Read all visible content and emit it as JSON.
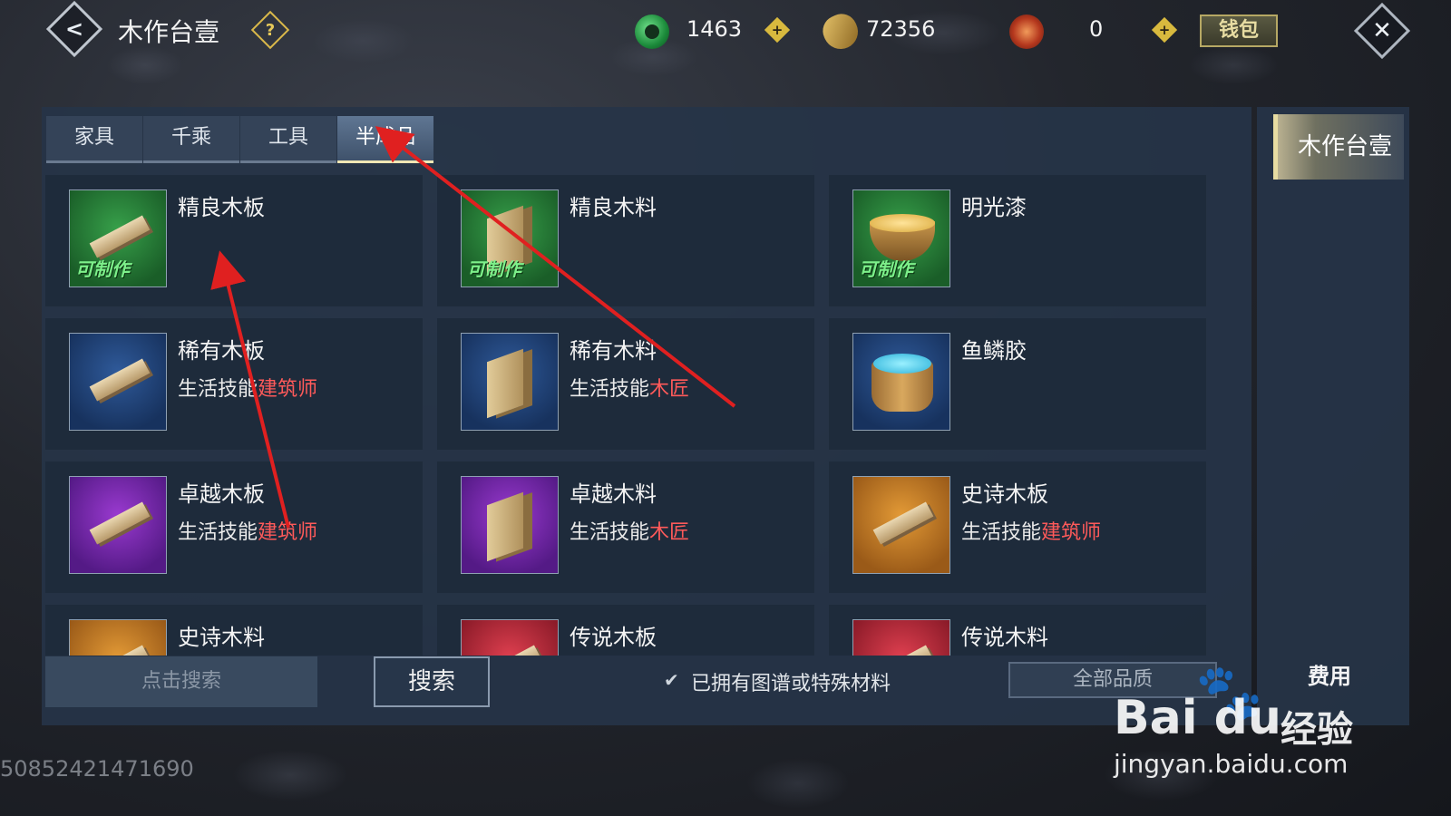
{
  "header": {
    "title": "木作台壹",
    "currencies": [
      {
        "icon": "jade-icon",
        "value": "1463"
      },
      {
        "icon": "coin-icon",
        "value": "72356"
      },
      {
        "icon": "ticket-icon",
        "value": "0"
      }
    ],
    "wallet_label": "钱包"
  },
  "tabs": [
    {
      "label": "家具",
      "active": false
    },
    {
      "label": "千乘",
      "active": false
    },
    {
      "label": "工具",
      "active": false
    },
    {
      "label": "半成品",
      "active": true
    }
  ],
  "items": [
    {
      "name": "精良木板",
      "quality": "green",
      "icon": "plank-icon",
      "craftable": "可制作",
      "skill_prefix": "",
      "skill_role": ""
    },
    {
      "name": "精良木料",
      "quality": "green",
      "icon": "block-icon",
      "craftable": "可制作",
      "skill_prefix": "",
      "skill_role": ""
    },
    {
      "name": "明光漆",
      "quality": "green",
      "icon": "bowl-icon",
      "craftable": "可制作",
      "skill_prefix": "",
      "skill_role": ""
    },
    {
      "name": "稀有木板",
      "quality": "blue",
      "icon": "plank-icon",
      "craftable": "",
      "skill_prefix": "生活技能",
      "skill_role": "建筑师"
    },
    {
      "name": "稀有木料",
      "quality": "blue",
      "icon": "block-icon",
      "craftable": "",
      "skill_prefix": "生活技能",
      "skill_role": "木匠"
    },
    {
      "name": "鱼鳞胶",
      "quality": "blue",
      "icon": "bucket-icon",
      "craftable": "",
      "skill_prefix": "",
      "skill_role": ""
    },
    {
      "name": "卓越木板",
      "quality": "purple",
      "icon": "plank-icon",
      "craftable": "",
      "skill_prefix": "生活技能",
      "skill_role": "建筑师"
    },
    {
      "name": "卓越木料",
      "quality": "purple",
      "icon": "block-icon",
      "craftable": "",
      "skill_prefix": "生活技能",
      "skill_role": "木匠"
    },
    {
      "name": "史诗木板",
      "quality": "orange",
      "icon": "plank-icon",
      "craftable": "",
      "skill_prefix": "生活技能",
      "skill_role": "建筑师"
    },
    {
      "name": "史诗木料",
      "quality": "orange",
      "icon": "plank-icon",
      "craftable": "",
      "skill_prefix": "",
      "skill_role": ""
    },
    {
      "name": "传说木板",
      "quality": "red",
      "icon": "plank-icon",
      "craftable": "",
      "skill_prefix": "",
      "skill_role": ""
    },
    {
      "name": "传说木料",
      "quality": "red",
      "icon": "plank-icon",
      "craftable": "",
      "skill_prefix": "",
      "skill_role": ""
    }
  ],
  "bottom": {
    "search_placeholder": "点击搜索",
    "search_button": "搜索",
    "filter_label": "已拥有图谱或特殊材料",
    "quality_select": "全部品质"
  },
  "side_panel": {
    "workbench_label": "木作台壹"
  },
  "overlay": {
    "user_id": "50852421471690",
    "watermark_logo": "Bai du",
    "watermark_brand": "经验",
    "watermark_badge": "费用",
    "watermark_url": "jingyan.baidu.com"
  },
  "colors": {
    "skill_role": "#ff5a5a",
    "craftable": "#7df08a",
    "arrow": "#e02020"
  }
}
